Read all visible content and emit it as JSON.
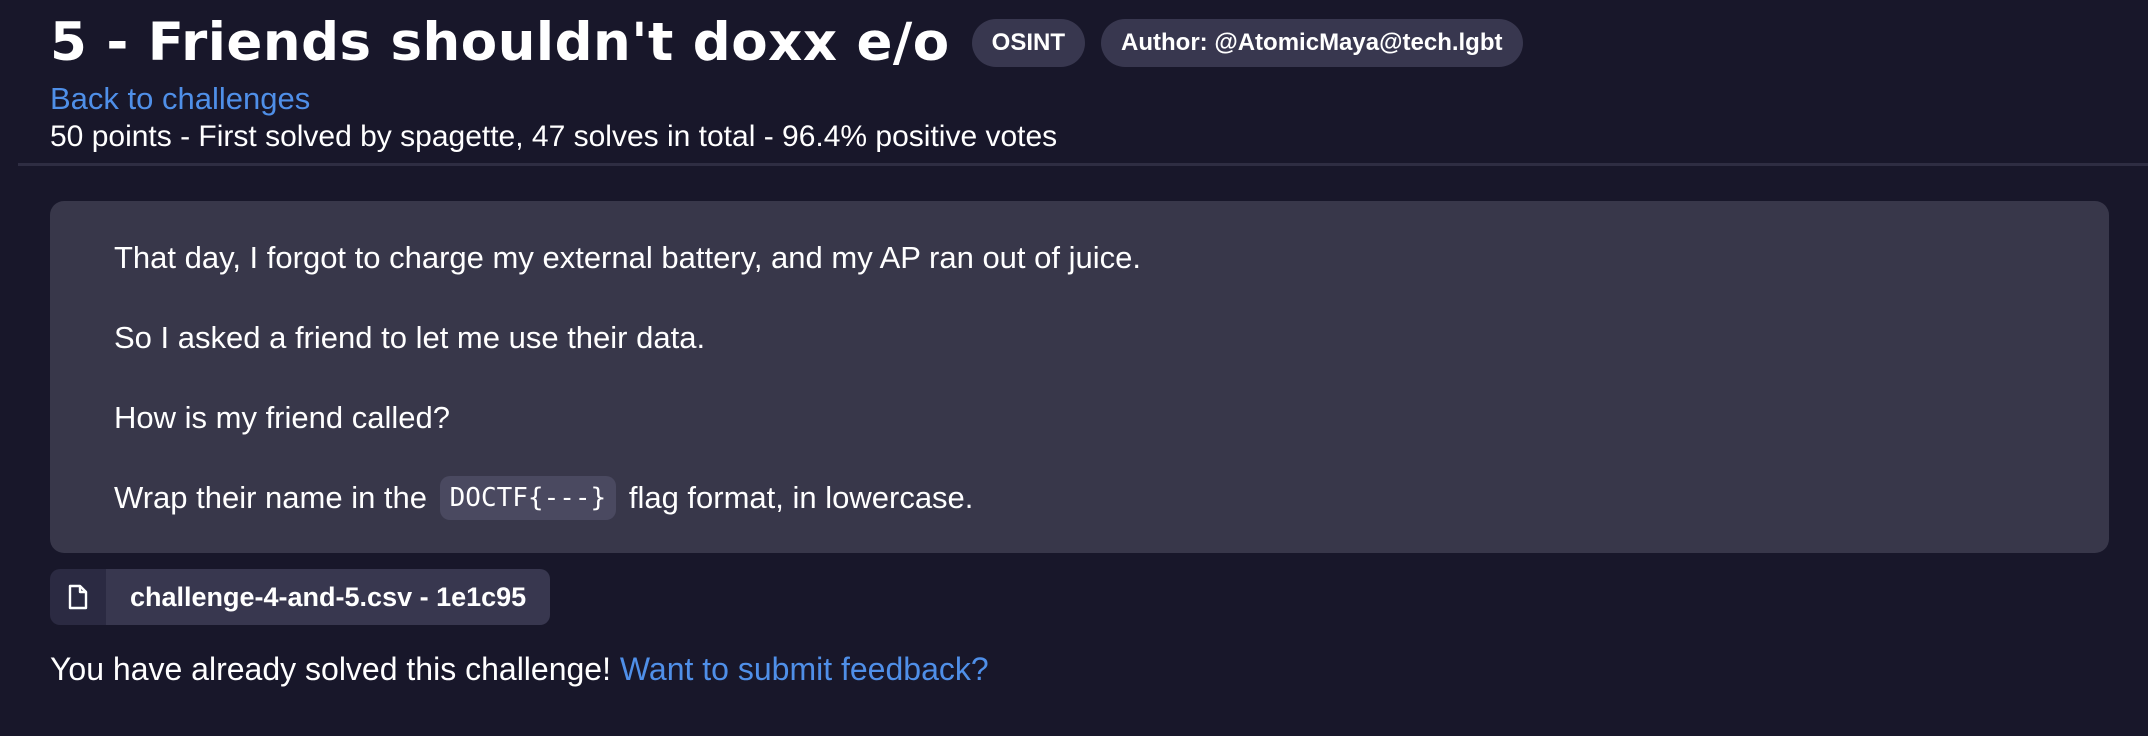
{
  "challenge": {
    "title": "5 - Friends shouldn't doxx e/o",
    "category_badge": "OSINT",
    "author_badge": "Author: @AtomicMaya@tech.lgbt",
    "back_link": "Back to challenges",
    "meta": "50 points - First solved by spagette, 47 solves in total - 96.4% positive votes"
  },
  "description": {
    "line1": "That day, I forgot to charge my external battery, and my AP ran out of juice.",
    "line2": "So I asked a friend to let me use their data.",
    "line3": "How is my friend called?",
    "line4_prefix": "Wrap their name in the",
    "line4_code": "DOCTF{---}",
    "line4_suffix": "flag format, in lowercase."
  },
  "attachment": {
    "icon": "file-icon",
    "label": "challenge-4-and-5.csv - 1e1c95"
  },
  "status": {
    "solved_text": "You have already solved this challenge!",
    "feedback_link": "Want to submit feedback?"
  },
  "colors": {
    "background": "#18172a",
    "panel": "#38374a",
    "link": "#4f8fe8",
    "badge": "#38374f"
  }
}
